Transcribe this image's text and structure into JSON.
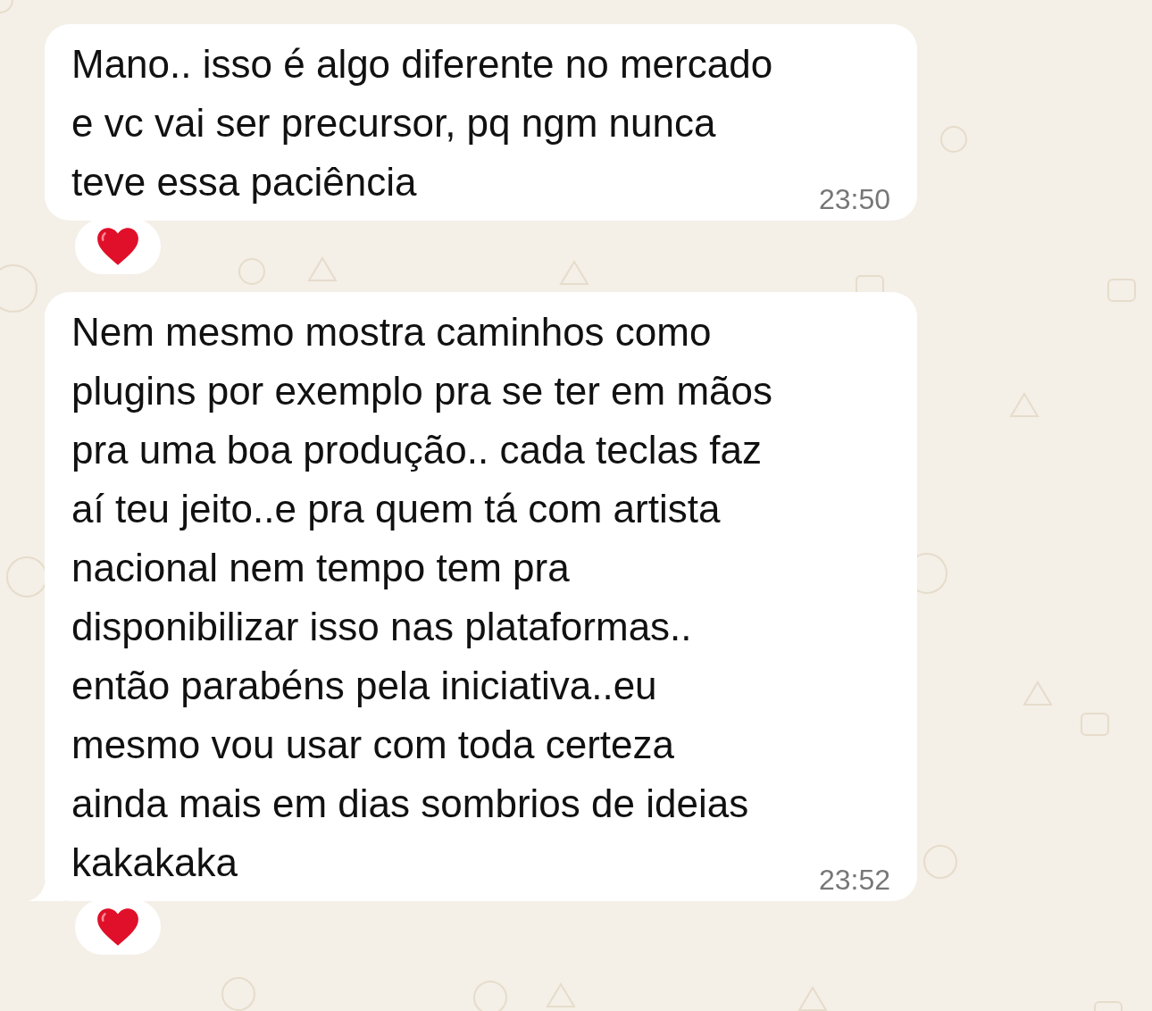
{
  "messages": [
    {
      "lines": [
        "Mano.. isso é algo diferente no mercado",
        "e vc vai ser precursor, pq ngm nunca",
        "teve essa paciência"
      ],
      "time": "23:50",
      "tail": false,
      "reacted": true
    },
    {
      "lines": [
        "Nem mesmo mostra caminhos como",
        "plugins por exemplo pra se ter em mãos",
        "pra uma boa produção.. cada teclas faz",
        "aí teu jeito..e pra quem tá com artista",
        "nacional nem tempo tem pra",
        "disponibilizar isso nas plataformas..",
        "então parabéns pela iniciativa..eu",
        "mesmo vou usar com toda certeza",
        "ainda mais em dias sombrios de ideias",
        "kakakaka"
      ],
      "time": "23:52",
      "tail": true,
      "reacted": true
    }
  ]
}
